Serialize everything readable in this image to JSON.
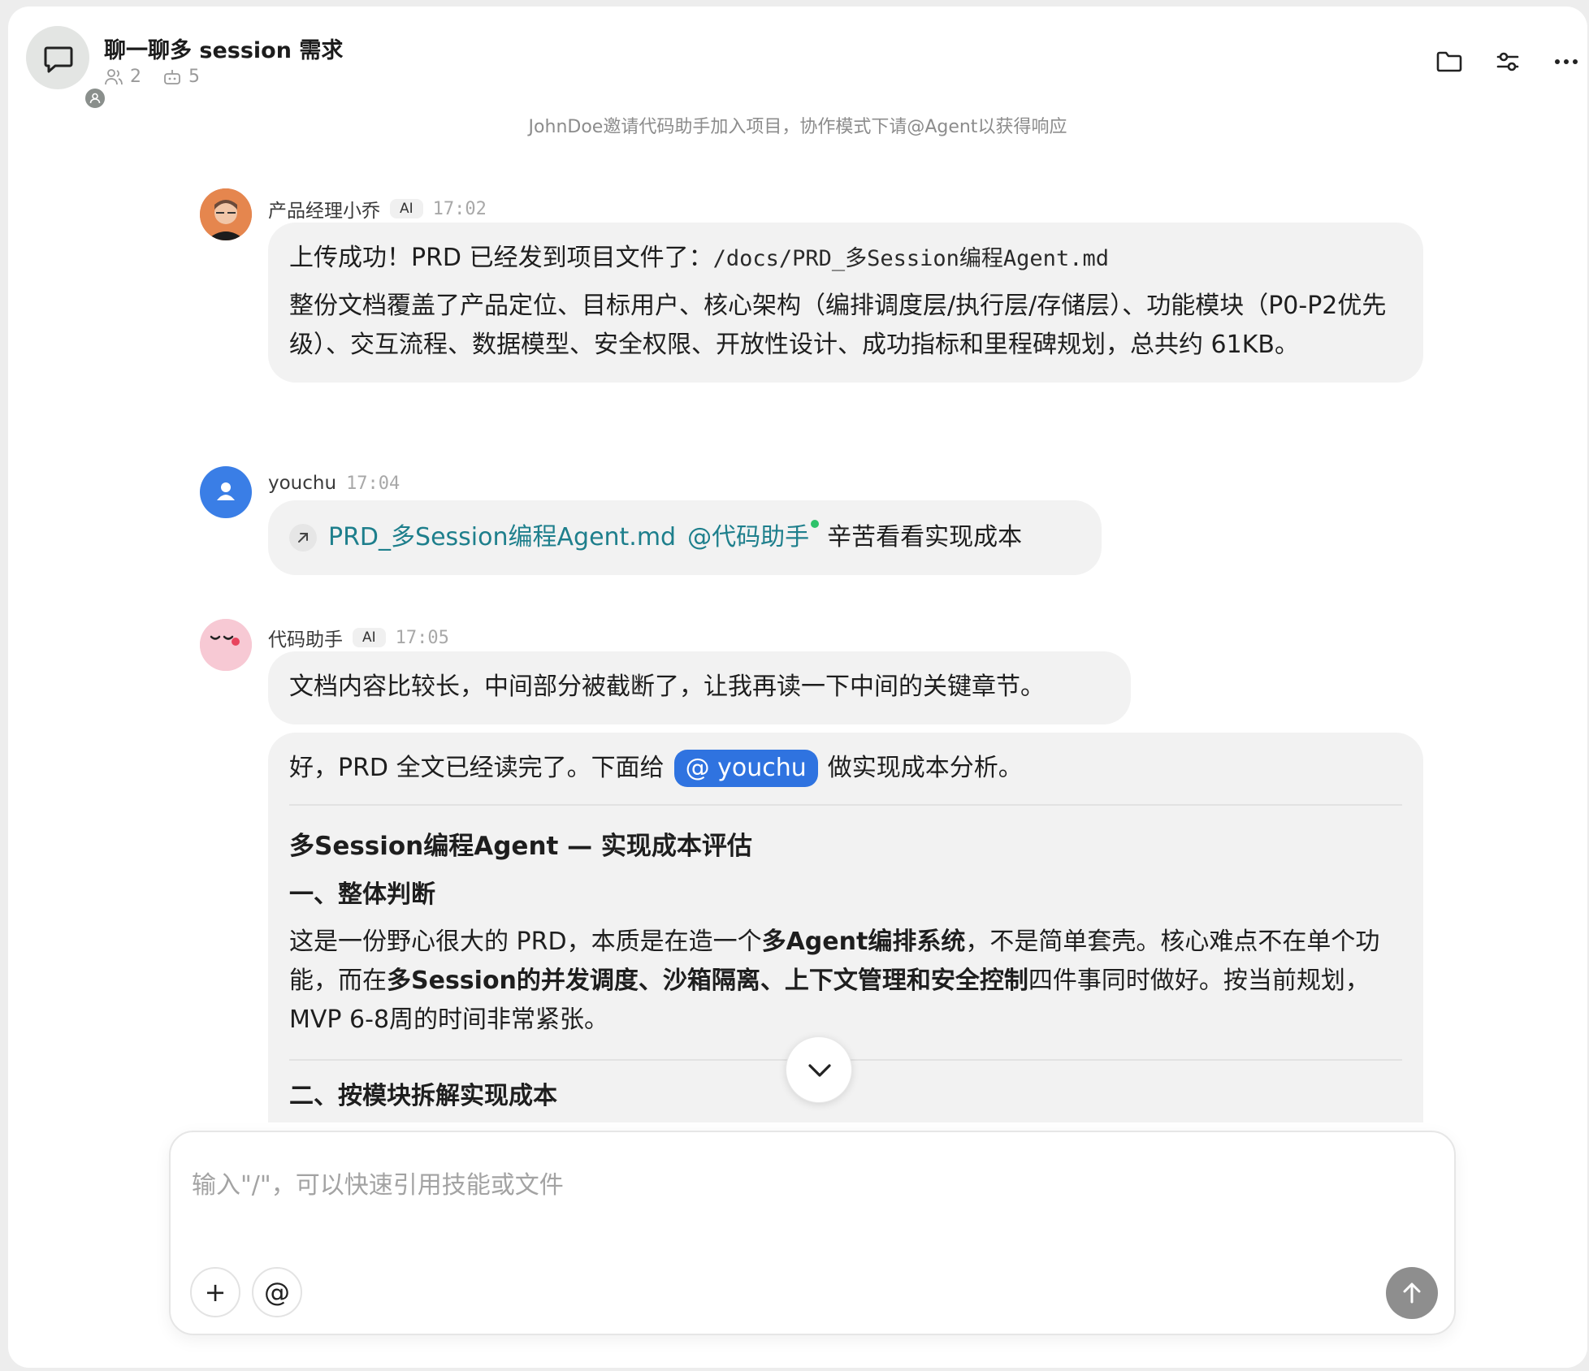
{
  "header": {
    "title": "聊一聊多 session 需求",
    "members_count": "2",
    "bots_count": "5"
  },
  "notice": "JohnDoe邀请代码助手加入项目，协作模式下请@Agent以获得响应",
  "messages": [
    {
      "name": "产品经理小乔",
      "ai_tag": "AI",
      "time": "17:02",
      "line1_text": "上传成功！PRD 已经发到项目文件了：",
      "line1_path": "/docs/PRD_多Session编程Agent.md",
      "line2": "整份文档覆盖了产品定位、目标用户、核心架构（编排调度层/执行层/存储层）、功能模块（P0-P2优先级）、交互流程、数据模型、安全权限、开放性设计、成功指标和里程碑规划，总共约 61KB。"
    },
    {
      "name": "youchu",
      "time": "17:04",
      "file_link": "PRD_多Session编程Agent.md",
      "mention": "@代码助手",
      "text": "辛苦看看实现成本"
    },
    {
      "name": "代码助手",
      "ai_tag": "AI",
      "time": "17:05",
      "text": "文档内容比较长，中间部分被截断了，让我再读一下中间的关键章节。"
    }
  ],
  "reply": {
    "intro_before": "好，PRD 全文已经读完了。下面给",
    "mention": "@ youchu",
    "intro_after": "做实现成本分析。",
    "heading": "多Session编程Agent — 实现成本评估",
    "section1": "一、整体判断",
    "p1_a": "这是一份野心很大的 PRD，本质是在造一个",
    "p1_b": "多Agent编排系统",
    "p1_c": "，不是简单套壳。核心难点不在单个功能，而在",
    "p1_d": "多Session的并发调度、沙箱隔离、上下文管理和安全控制",
    "p1_e": "四件事同时做好。按当前规划，MVP 6-8周的时间非常紧张。",
    "section2": "二、按模块拆解实现成本"
  },
  "composer": {
    "placeholder": "输入\"/\"，可以快速引用技能或文件",
    "add_label": "+",
    "at_label": "@"
  }
}
